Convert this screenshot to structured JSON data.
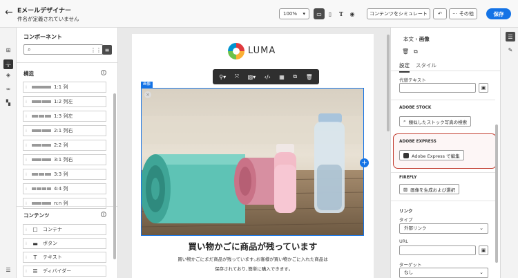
{
  "header": {
    "title": "Eメールデザイナー",
    "subtitle": "件名が定義されていません",
    "zoom": "100%",
    "simulate_label": "コンテンツをシミュレート",
    "more_label": "その他",
    "save_label": "保存"
  },
  "left_panel": {
    "title": "コンポーネント",
    "structure_title": "構造",
    "structure_items": [
      {
        "label": "1:1 列",
        "cols": 1
      },
      {
        "label": "1:2 列左",
        "cols": 2
      },
      {
        "label": "1:3 列左",
        "cols": 3
      },
      {
        "label": "2:1 列右",
        "cols": 2
      },
      {
        "label": "2:2 列",
        "cols": 2
      },
      {
        "label": "3:1 列右",
        "cols": 2
      },
      {
        "label": "3:3 列",
        "cols": 3
      },
      {
        "label": "4:4 列",
        "cols": 4
      },
      {
        "label": "n:n 列",
        "cols": 2
      }
    ],
    "content_title": "コンテンツ",
    "content_items": [
      {
        "label": "コンテナ",
        "icon": "container-icon"
      },
      {
        "label": "ボタン",
        "icon": "button-icon"
      },
      {
        "label": "テキスト",
        "icon": "text-icon"
      },
      {
        "label": "ディバイダー",
        "icon": "divider-icon"
      }
    ]
  },
  "canvas": {
    "brand": "LUMA",
    "selected_badge": "画像",
    "headline": "買い物かごに商品が残っています",
    "body_line1": "買い物かごにまだ商品が残っています｡お客様が買い物かごに入れた商品は",
    "body_line2": "保存されており､簡単に購入できます｡"
  },
  "right_panel": {
    "breadcrumb_parent": "本文",
    "breadcrumb_current": "画像",
    "tab_settings": "設定",
    "tab_style": "スタイル",
    "alt_text_label": "代替テキスト",
    "adobe_stock_title": "ADOBE STOCK",
    "stock_button": "類似したストック写真の検索",
    "adobe_express_title": "ADOBE EXPRESS",
    "express_button": "Adobe Express で編集",
    "firefly_title": "FIREFLY",
    "firefly_button": "画像を生成および選択",
    "link_title": "リンク",
    "type_label": "タイプ",
    "type_value": "外部リンク",
    "url_label": "URL",
    "target_label": "ターゲット",
    "target_value": "なし"
  },
  "colors": {
    "accent": "#1473e6",
    "highlight_border": "#c0392b"
  }
}
